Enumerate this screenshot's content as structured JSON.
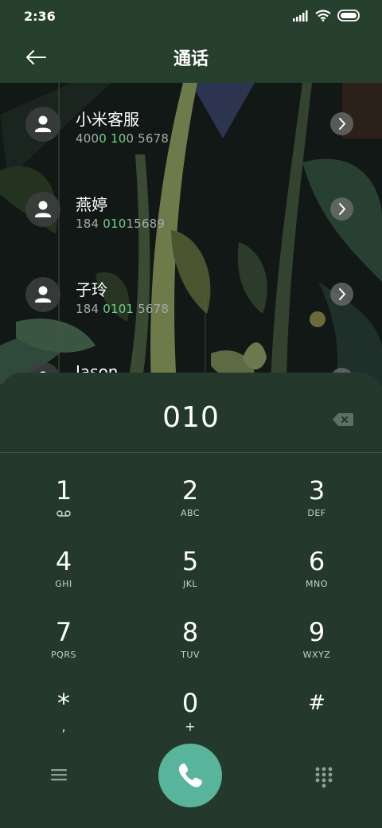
{
  "status_bar": {
    "time": "2:36",
    "icons": [
      "signal-icon",
      "wifi-icon",
      "battery-icon"
    ]
  },
  "header": {
    "title": "通话",
    "back_icon": "arrow-left-icon"
  },
  "contacts": [
    {
      "name": "小米客服",
      "number_parts": [
        "400",
        "0 10",
        "0 5678"
      ]
    },
    {
      "name": "燕婷",
      "number_parts": [
        "184 ",
        "010",
        "15689"
      ]
    },
    {
      "name": "子玲",
      "number_parts": [
        "184 ",
        "0101",
        " 5678"
      ]
    },
    {
      "name": "Jason",
      "number_parts": [
        "",
        "",
        ""
      ]
    }
  ],
  "dialpad": {
    "number": "010",
    "keys": [
      {
        "digit": "1",
        "letters": ""
      },
      {
        "digit": "2",
        "letters": "ABC"
      },
      {
        "digit": "3",
        "letters": "DEF"
      },
      {
        "digit": "4",
        "letters": "GHI"
      },
      {
        "digit": "5",
        "letters": "JKL"
      },
      {
        "digit": "6",
        "letters": "MNO"
      },
      {
        "digit": "7",
        "letters": "PQRS"
      },
      {
        "digit": "8",
        "letters": "TUV"
      },
      {
        "digit": "9",
        "letters": "WXYZ"
      },
      {
        "digit": "*",
        "letters": ","
      },
      {
        "digit": "0",
        "letters": "+"
      },
      {
        "digit": "#",
        "letters": ""
      }
    ]
  },
  "colors": {
    "background": "#24392b",
    "header": "#26402d",
    "highlight": "#6fd08c",
    "call_button": "#58b49a"
  }
}
